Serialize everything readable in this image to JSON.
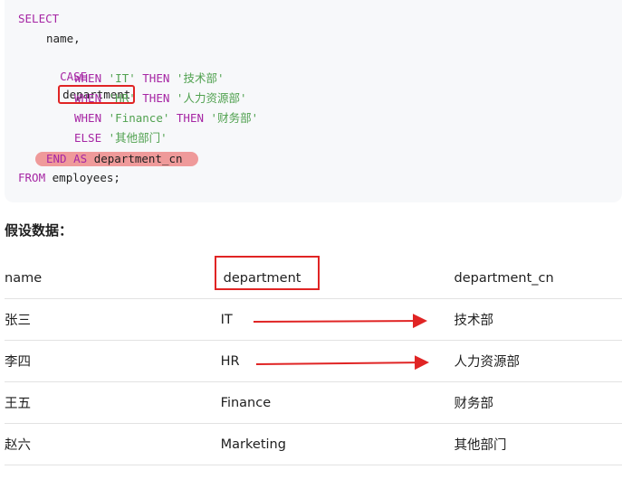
{
  "code": {
    "line1": "SELECT",
    "line2": "name,",
    "case_kw": "CASE",
    "case_field": "department",
    "when_kw": "WHEN",
    "then_kw": "THEN",
    "w1_value": "'IT'",
    "w1_result": "'技术部'",
    "w2_value": "'HR'",
    "w2_result": "'人力资源部'",
    "w3_value": "'Finance'",
    "w3_result": "'财务部'",
    "else_kw": "ELSE",
    "else_result": "'其他部门'",
    "end_kw": "END AS",
    "end_alias": "department_cn",
    "from_kw": "FROM",
    "from_table": "employees;"
  },
  "section_title": "假设数据：",
  "table": {
    "headers": [
      "name",
      "department",
      "department_cn"
    ],
    "rows": [
      [
        "张三",
        "IT",
        "技术部"
      ],
      [
        "李四",
        "HR",
        "人力资源部"
      ],
      [
        "王五",
        "Finance",
        "财务部"
      ],
      [
        "赵六",
        "Marketing",
        "其他部门"
      ]
    ]
  },
  "colors": {
    "keyword": "#a626a4",
    "string": "#50a14f",
    "annotation_red": "#e02424",
    "highlight_pink": "#ef9a9a"
  }
}
